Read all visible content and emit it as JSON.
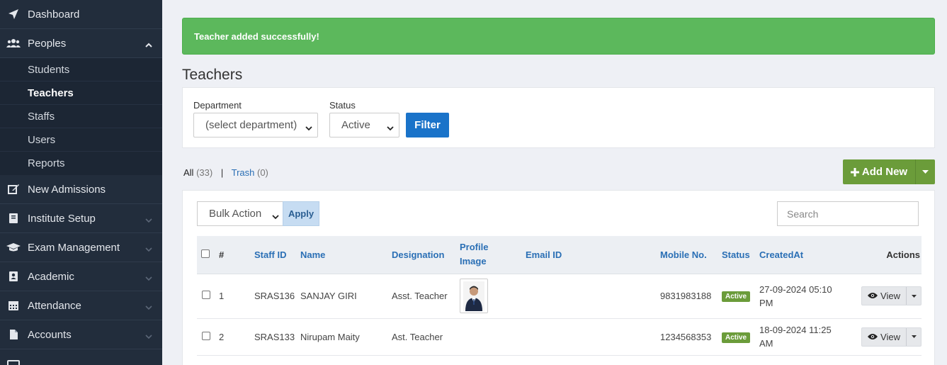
{
  "sidebar": {
    "items": [
      {
        "label": "Dashboard",
        "icon": "paper-plane-icon"
      },
      {
        "label": "Peoples",
        "icon": "users-icon"
      },
      {
        "label": "New Admissions",
        "icon": "edit-icon"
      },
      {
        "label": "Institute Setup",
        "icon": "book-icon"
      },
      {
        "label": "Exam Management",
        "icon": "graduation-cap-icon"
      },
      {
        "label": "Academic",
        "icon": "address-book-icon"
      },
      {
        "label": "Attendance",
        "icon": "calendar-icon"
      },
      {
        "label": "Accounts",
        "icon": "file-icon"
      }
    ],
    "peoples_sub": [
      "Students",
      "Teachers",
      "Staffs",
      "Users",
      "Reports"
    ],
    "active_sub": "Teachers"
  },
  "alert": {
    "message": "Teacher added successfully!",
    "color": "#5cb85c"
  },
  "page": {
    "title": "Teachers"
  },
  "filter": {
    "department_label": "Department",
    "department_value": "(select department)",
    "status_label": "Status",
    "status_value": "Active",
    "filter_button": "Filter"
  },
  "views": {
    "all_label": "All",
    "all_count": "(33)",
    "trash_label": "Trash",
    "trash_count": "(0)"
  },
  "add_new": {
    "label": "Add New",
    "color": "#6b9c3a"
  },
  "table_tools": {
    "bulk_action": "Bulk Action",
    "apply": "Apply",
    "search_placeholder": "Search"
  },
  "table": {
    "headers": {
      "num": "#",
      "staff_id": "Staff ID",
      "name": "Name",
      "designation": "Designation",
      "profile_image_1": "Profile",
      "profile_image_2": "Image",
      "email": "Email ID",
      "mobile": "Mobile No.",
      "status": "Status",
      "created": "CreatedAt",
      "actions": "Actions"
    },
    "rows": [
      {
        "num": "1",
        "staff_id": "SRAS136",
        "name": "SANJAY GIRI",
        "designation": "Asst. Teacher",
        "email": "",
        "mobile": "9831983188",
        "status": "Active",
        "created_1": "27-09-2024 05:10",
        "created_2": "PM",
        "view": "View"
      },
      {
        "num": "2",
        "staff_id": "SRAS133",
        "name": "Nirupam Maity",
        "designation": "Ast. Teacher",
        "email": "",
        "mobile": "1234568353",
        "status": "Active",
        "created_1": "18-09-2024 11:25",
        "created_2": "AM",
        "view": "View"
      }
    ]
  }
}
